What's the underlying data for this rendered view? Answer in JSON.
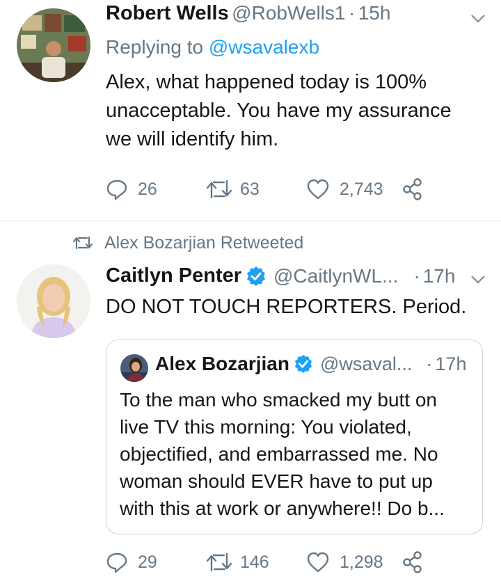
{
  "tweet1": {
    "name": "Robert Wells",
    "handle": "@RobWells1",
    "time": "15h",
    "replying_prefix": "Replying to",
    "replying_handle": "@wsavalexb",
    "text": "Alex, what happened today is 100% unacceptable. You have my assurance we will identify him.",
    "replies": "26",
    "retweets": "63",
    "likes": "2,743"
  },
  "tweet2": {
    "retweeted_by": "Alex Bozarjian Retweeted",
    "name": "Caitlyn Penter",
    "handle": "@CaitlynWL...",
    "time": "17h",
    "text": "DO NOT TOUCH REPORTERS. Period.",
    "quote": {
      "name": "Alex Bozarjian",
      "handle": "@wsaval...",
      "time": "17h",
      "text": "To the man who smacked my butt on live TV this morning: You violated, objectified, and embarrassed me. No woman should EVER have to put up with this at work or anywhere!! Do b..."
    },
    "replies": "29",
    "retweets": "146",
    "likes": "1,298"
  },
  "colors": {
    "accent": "#1da1f2",
    "secondary_text": "#657786",
    "primary_text": "#14171a"
  }
}
